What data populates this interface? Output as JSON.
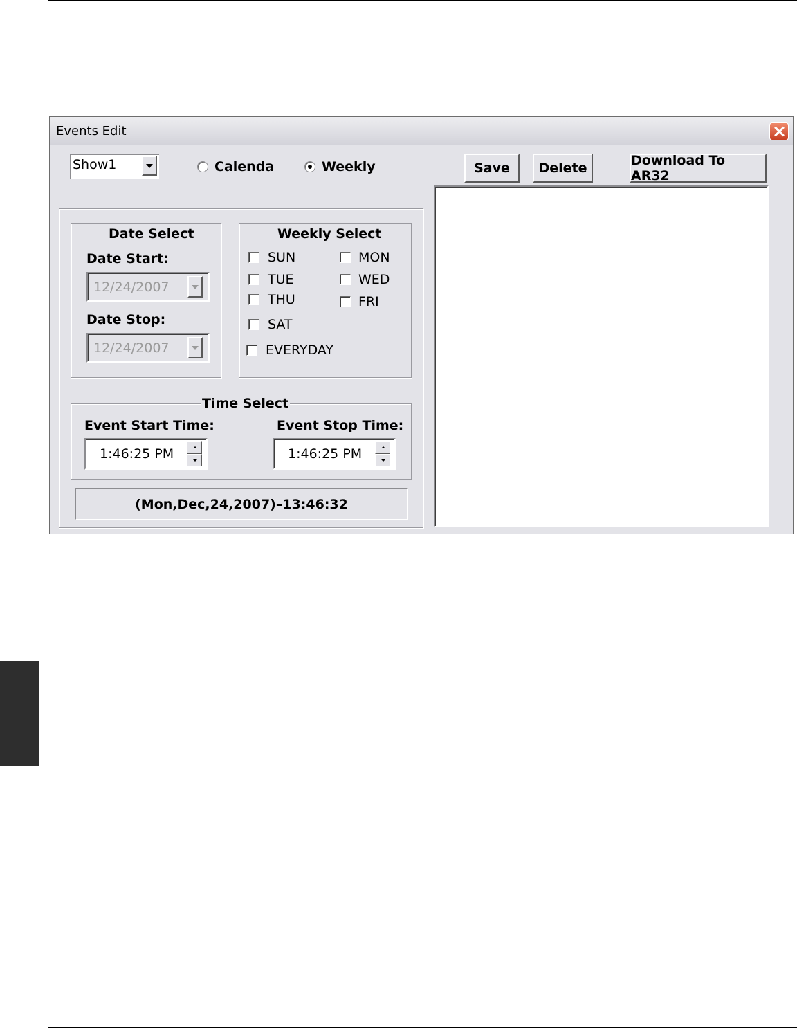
{
  "window": {
    "title": "Events Edit"
  },
  "toolbar": {
    "show_select_value": "Show1",
    "mode_calendar_label": "Calenda",
    "mode_weekly_label": "Weekly",
    "mode_selected": "Weekly",
    "save_label": "Save",
    "delete_label": "Delete",
    "download_label": "Download To AR32"
  },
  "date_select": {
    "legend": "Date Select",
    "start_label": "Date Start:",
    "start_value": "12/24/2007",
    "stop_label": "Date Stop:",
    "stop_value": "12/24/2007"
  },
  "weekly_select": {
    "legend": "Weekly Select",
    "days": {
      "sun": "SUN",
      "mon": "MON",
      "tue": "TUE",
      "wed": "WED",
      "thu": "THU",
      "fri": "FRI",
      "sat": "SAT",
      "everyday": "EVERYDAY"
    }
  },
  "time_select": {
    "legend": "Time Select",
    "start_label": "Event Start Time:",
    "start_value": "1:46:25 PM",
    "stop_label": "Event Stop Time:",
    "stop_value": "1:46:25 PM"
  },
  "status": {
    "clock": "(Mon,Dec,24,2007)–13:46:32"
  }
}
